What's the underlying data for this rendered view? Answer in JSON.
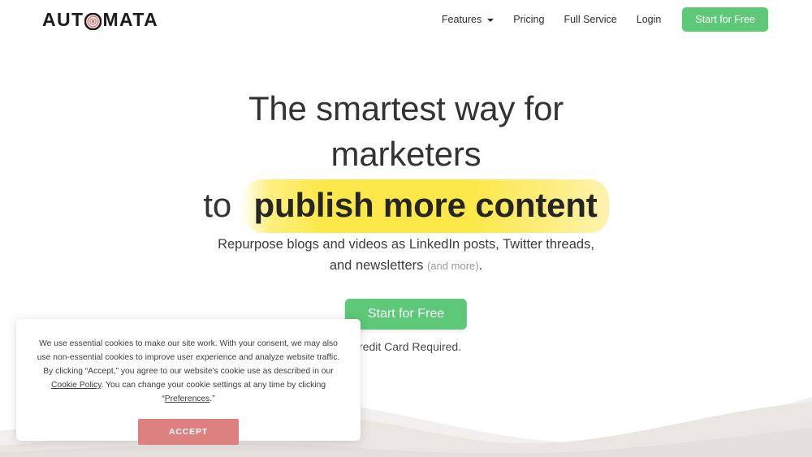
{
  "brand": {
    "name_part1": "AUT",
    "name_part2": "MATA",
    "logo_icon": "bullseye-target-icon",
    "accent_green": "#5cc878",
    "accent_red": "#dd8080",
    "highlight_yellow": "#fce848",
    "logo_mark_red": "#e8746f"
  },
  "nav": {
    "items": [
      {
        "label": "Features",
        "has_dropdown": true,
        "icon": "chevron-down-icon"
      },
      {
        "label": "Pricing",
        "has_dropdown": false
      },
      {
        "label": "Full Service",
        "has_dropdown": false
      },
      {
        "label": "Login",
        "has_dropdown": false
      }
    ],
    "cta_label": "Start for Free"
  },
  "hero": {
    "title_line1": "The smartest way for",
    "title_line2": "marketers",
    "title_line3_lead": "to",
    "title_line3_highlight": "publish more content",
    "subtitle_main": "Repurpose blogs and videos as LinkedIn posts, Twitter threads, and newsletters",
    "subtitle_muted": "(and more)",
    "subtitle_tail": ".",
    "cta_label": "Start for Free",
    "note": "Credit Card Required."
  },
  "cookie_banner": {
    "text_part1": "We use essential cookies to make our site work. With your consent, we may also use non-essential cookies to improve user experience and analyze website traffic. By clicking “Accept,” you agree to our website's cookie use as described in our ",
    "link_policy": "Cookie Policy",
    "text_part2": ". You can change your cookie settings at any time by clicking “",
    "link_preferences": "Preferences",
    "text_part3": ".”",
    "accept_label": "ACCEPT"
  }
}
